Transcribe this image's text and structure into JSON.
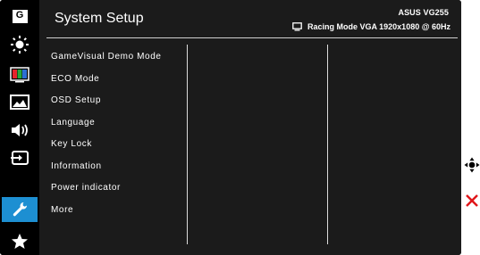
{
  "header": {
    "title": "System Setup",
    "model": "ASUS VG255",
    "mode_info": "Racing Mode VGA 1920x1080 @ 60Hz"
  },
  "sidebar": {
    "items": [
      {
        "icon": "gamevisual-icon",
        "label": "G"
      },
      {
        "icon": "brightness-icon"
      },
      {
        "icon": "color-icon"
      },
      {
        "icon": "image-icon"
      },
      {
        "icon": "sound-icon"
      },
      {
        "icon": "input-select-icon"
      },
      {
        "icon": "system-setup-icon",
        "active": true
      },
      {
        "icon": "favorite-star-icon"
      }
    ],
    "active_color": "#1d8fd2"
  },
  "menu": {
    "items": [
      "GameVisual Demo Mode",
      "ECO Mode",
      "OSD Setup",
      "Language",
      "Key Lock",
      "Information",
      "Power indicator",
      "More"
    ]
  },
  "side_buttons": [
    {
      "icon": "navigate-joystick-icon"
    },
    {
      "icon": "close-icon",
      "color": "#e0161a"
    }
  ]
}
